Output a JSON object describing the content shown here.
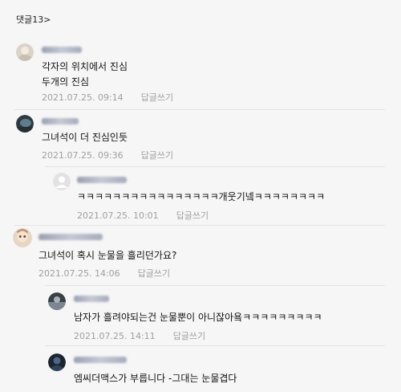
{
  "header": {
    "title": "댓글13>"
  },
  "comments": [
    {
      "lines": [
        "각자의 위치에서 진심",
        "두개의 진심"
      ],
      "date": "2021.07.25. 09:14",
      "reply_label": "답글쓰기",
      "avatar_icon": "profile-photo-icon"
    },
    {
      "lines": [
        "그녀석이 더 진심인듯"
      ],
      "date": "2021.07.25. 09:36",
      "reply_label": "답글쓰기",
      "avatar_icon": "profile-photo-icon"
    },
    {
      "lines": [
        "ㅋㅋㅋㅋㅋㅋㅋㅋㅋㅋㅋㅋㅋㅋㅋㅋ개웃기넼ㅋㅋㅋㅋㅋㅋㅋㅋ"
      ],
      "date": "2021.07.25. 10:01",
      "reply_label": "답글쓰기",
      "avatar_icon": "default-avatar-icon"
    },
    {
      "lines": [
        "그녀석이 혹시 눈물을 흘리던가요?"
      ],
      "date": "2021.07.25. 14:06",
      "reply_label": "답글쓰기",
      "avatar_icon": "profile-photo-icon"
    },
    {
      "lines": [
        "남자가 흘려야되는건 눈물뿐이 아니잖아욬ㅋㅋㅋㅋㅋㅋㅋㅋㅋ"
      ],
      "date": "2021.07.25. 14:11",
      "reply_label": "답글쓰기",
      "avatar_icon": "profile-photo-icon"
    },
    {
      "lines": [
        "엠씨더맥스가 부릅니다 -그대는 눈물겹다"
      ],
      "date": "",
      "reply_label": "",
      "avatar_icon": "profile-photo-icon"
    }
  ]
}
